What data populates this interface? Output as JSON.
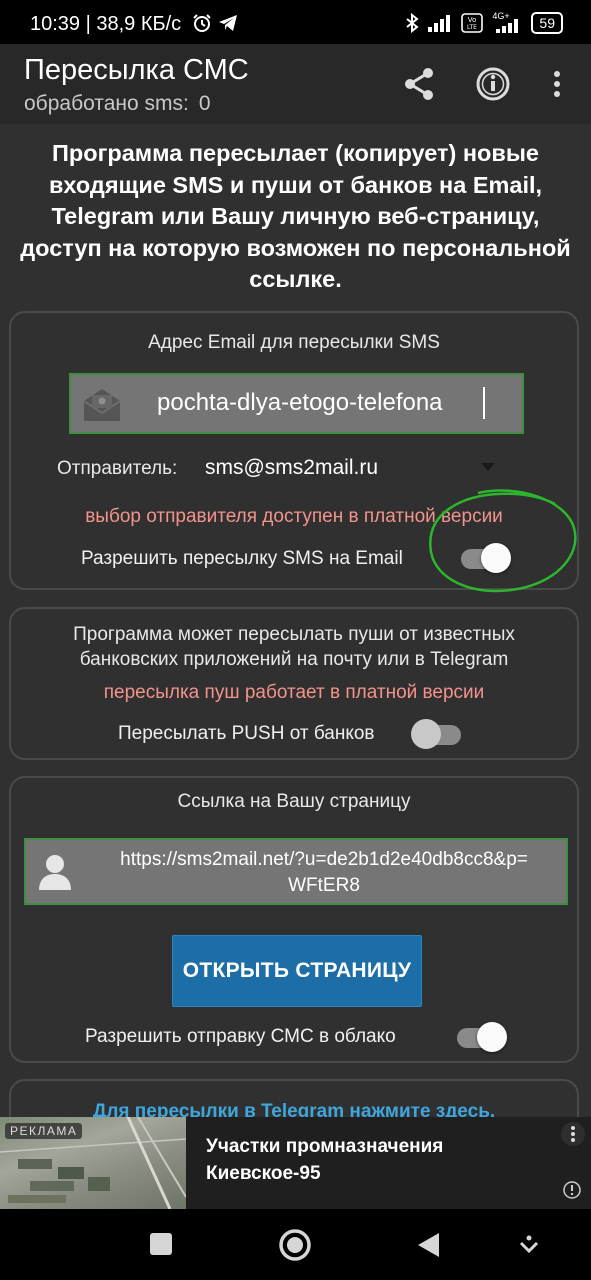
{
  "status_bar": {
    "time": "10:39 | 38,9 КБ/с",
    "network": "4G+",
    "battery": "59"
  },
  "app_bar": {
    "title": "Пересылка СМС",
    "subtitle": "обработано sms:",
    "count": "0"
  },
  "intro": "Программа пересылает (копирует) новые входящие SMS и пуши от банков на Email, Telegram или Вашу личную веб-страницу, доступ на которую возможен по персональной ссылке.",
  "email_card": {
    "heading": "Адрес Email для пересылки SMS",
    "email_value": "pochta-dlya-etogo-telefona",
    "sender_label": "Отправитель:",
    "sender_value": "sms@sms2mail.ru",
    "paid_note": "выбор отправителя доступен в платной версии",
    "toggle_label": "Разрешить пересылку SMS на Email",
    "toggle_on": true
  },
  "push_card": {
    "description": "Программа может пересылать пуши от известных банковских приложений на почту или в Telegram",
    "paid_note": "пересылка пуш работает в платной версии",
    "toggle_label": "Пересылать PUSH от банков",
    "toggle_on": false
  },
  "page_card": {
    "heading": "Ссылка на Вашу страницу",
    "link_line1": "https://sms2mail.net/?u=de2b1d2e40db8cc8&p=",
    "link_line2": "WFtER8",
    "open_button": "ОТКРЫТЬ СТРАНИЦУ",
    "toggle_label": "Разрешить отправку СМС в облако",
    "toggle_on": true
  },
  "telegram_link": "Для пересылки в Telegram нажмите здесь.",
  "ad": {
    "label": "РЕКЛАМА",
    "title_line1": "Участки промназначения",
    "title_line2": "Киевское-95"
  },
  "colors": {
    "background": "#303030",
    "app_bar": "#282828",
    "accent_button": "#1d6ea6",
    "paid_note": "#f2938c",
    "link": "#3ea6dd",
    "annotation": "#2db52d"
  }
}
